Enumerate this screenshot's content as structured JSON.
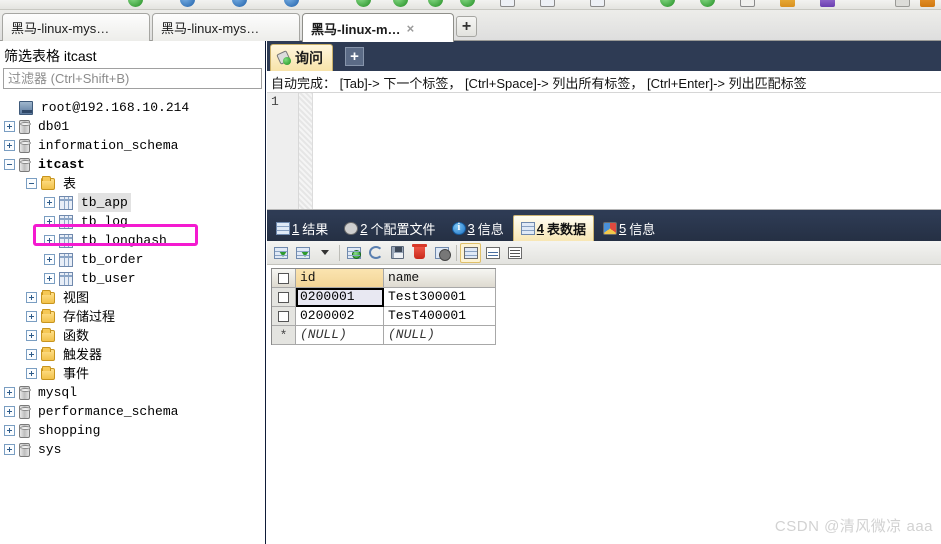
{
  "window_tabs": [
    {
      "label": "黑马-linux-mys…",
      "active": false,
      "closable": false
    },
    {
      "label": "黑马-linux-mys…",
      "active": false,
      "closable": false
    },
    {
      "label": "黑马-linux-m…",
      "active": true,
      "closable": true,
      "close_label": "×"
    }
  ],
  "new_tab_label": "+",
  "sidebar": {
    "title": "筛选表格 itcast",
    "filter_placeholder": "过滤器 (Ctrl+Shift+B)",
    "filter_value": "",
    "tree": [
      {
        "label": "root@192.168.10.214",
        "depth": 0,
        "expander": "none",
        "icon": "server-icon",
        "bold": false,
        "cjk": false,
        "selected": false
      },
      {
        "label": "db01",
        "depth": 0,
        "expander": "plus",
        "icon": "database-icon",
        "bold": false,
        "cjk": false,
        "selected": false
      },
      {
        "label": "information_schema",
        "depth": 0,
        "expander": "plus",
        "icon": "database-icon",
        "bold": false,
        "cjk": false,
        "selected": false
      },
      {
        "label": "itcast",
        "depth": 0,
        "expander": "minus",
        "icon": "database-icon",
        "bold": true,
        "cjk": false,
        "selected": false
      },
      {
        "label": "表",
        "depth": 1,
        "expander": "minus",
        "icon": "folder-icon",
        "bold": false,
        "cjk": true,
        "selected": false
      },
      {
        "label": "tb_app",
        "depth": 2,
        "expander": "plus",
        "icon": "table-icon",
        "bold": false,
        "cjk": false,
        "selected": true
      },
      {
        "label": "tb_log",
        "depth": 2,
        "expander": "plus",
        "icon": "table-icon",
        "bold": false,
        "cjk": false,
        "selected": false
      },
      {
        "label": "tb_longhash",
        "depth": 2,
        "expander": "plus",
        "icon": "table-icon",
        "bold": false,
        "cjk": false,
        "selected": false,
        "annotated": true
      },
      {
        "label": "tb_order",
        "depth": 2,
        "expander": "plus",
        "icon": "table-icon",
        "bold": false,
        "cjk": false,
        "selected": false
      },
      {
        "label": "tb_user",
        "depth": 2,
        "expander": "plus",
        "icon": "table-icon",
        "bold": false,
        "cjk": false,
        "selected": false
      },
      {
        "label": "视图",
        "depth": 1,
        "expander": "plus",
        "icon": "folder-icon",
        "bold": false,
        "cjk": true,
        "selected": false
      },
      {
        "label": "存储过程",
        "depth": 1,
        "expander": "plus",
        "icon": "folder-icon",
        "bold": false,
        "cjk": true,
        "selected": false
      },
      {
        "label": "函数",
        "depth": 1,
        "expander": "plus",
        "icon": "folder-icon",
        "bold": false,
        "cjk": true,
        "selected": false
      },
      {
        "label": "触发器",
        "depth": 1,
        "expander": "plus",
        "icon": "folder-icon",
        "bold": false,
        "cjk": true,
        "selected": false
      },
      {
        "label": "事件",
        "depth": 1,
        "expander": "plus",
        "icon": "folder-icon",
        "bold": false,
        "cjk": true,
        "selected": false
      },
      {
        "label": "mysql",
        "depth": 0,
        "expander": "plus",
        "icon": "database-icon",
        "bold": false,
        "cjk": false,
        "selected": false
      },
      {
        "label": "performance_schema",
        "depth": 0,
        "expander": "plus",
        "icon": "database-icon",
        "bold": false,
        "cjk": false,
        "selected": false
      },
      {
        "label": "shopping",
        "depth": 0,
        "expander": "plus",
        "icon": "database-icon",
        "bold": false,
        "cjk": false,
        "selected": false
      },
      {
        "label": "sys",
        "depth": 0,
        "expander": "plus",
        "icon": "database-icon",
        "bold": false,
        "cjk": false,
        "selected": false
      }
    ]
  },
  "query_panel": {
    "tab_label": "询问",
    "add_tab_label": "+",
    "autocomplete_hint": "自动完成： [Tab]-> 下一个标签， [Ctrl+Space]-> 列出所有标签， [Ctrl+Enter]-> 列出匹配标签",
    "line_numbers": [
      "1"
    ],
    "editor_text": ""
  },
  "result_tabs": [
    {
      "num": "1",
      "label": "结果",
      "icon": "grid-icon",
      "active": false
    },
    {
      "num": "2",
      "label": "个配置文件",
      "icon": "gear-icon",
      "active": false
    },
    {
      "num": "3",
      "label": "信息",
      "icon": "info-icon",
      "active": false
    },
    {
      "num": "4",
      "label": "表数据",
      "icon": "table-data-icon",
      "active": true
    },
    {
      "num": "5",
      "label": "信息",
      "icon": "pie-icon",
      "active": false
    }
  ],
  "grid_toolbar": [
    {
      "name": "import-grid-button",
      "kind": "grid-arrow"
    },
    {
      "name": "export-grid-button",
      "kind": "grid-arrow"
    },
    {
      "name": "dropdown-caret-button",
      "kind": "caret"
    },
    {
      "name": "separator-1",
      "kind": "sep"
    },
    {
      "name": "add-record-button",
      "kind": "add-record"
    },
    {
      "name": "refresh-button",
      "kind": "refresh"
    },
    {
      "name": "save-record-button",
      "kind": "save"
    },
    {
      "name": "delete-record-button",
      "kind": "trash"
    },
    {
      "name": "cancel-edit-button",
      "kind": "cancel"
    },
    {
      "name": "separator-2",
      "kind": "sep"
    },
    {
      "name": "grid-view-button",
      "kind": "view-a",
      "selected": true
    },
    {
      "name": "form-view-button",
      "kind": "view-b",
      "selected": false
    },
    {
      "name": "text-view-button",
      "kind": "view-c",
      "selected": false
    }
  ],
  "data_grid": {
    "columns": [
      {
        "key": "id",
        "label": "id",
        "active": true
      },
      {
        "key": "name",
        "label": "name",
        "active": false
      }
    ],
    "rows": [
      {
        "marker": "checkbox",
        "id": "0200001",
        "name": "Test300001",
        "focused_cell": "id"
      },
      {
        "marker": "checkbox",
        "id": "0200002",
        "name": "TesT400001",
        "focused_cell": null
      },
      {
        "marker": "star",
        "id": "(NULL)",
        "name": "(NULL)",
        "focused_cell": null,
        "is_null_row": true
      }
    ]
  },
  "watermark": "CSDN @清风微凉 aaa",
  "colors": {
    "accent_navy": "#2e3b54",
    "annotation_magenta": "#f41ad0",
    "active_tab_gold": "#f8e7b4",
    "column_header_orange": "#f3d597"
  }
}
